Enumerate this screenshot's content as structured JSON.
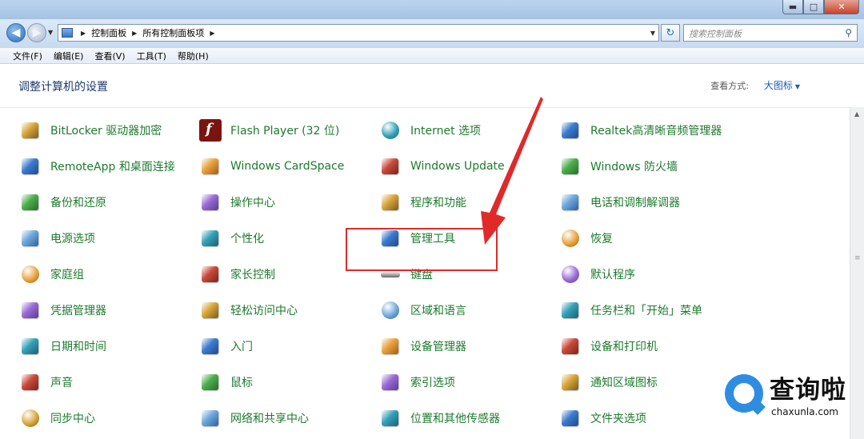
{
  "window": {
    "minimize_label": "▬",
    "maximize_label": "□",
    "close_label": "✕"
  },
  "address": {
    "breadcrumb": [
      "控制面板",
      "所有控制面板项"
    ],
    "search_placeholder": "搜索控制面板"
  },
  "menu": [
    "文件(F)",
    "编辑(E)",
    "查看(V)",
    "工具(T)",
    "帮助(H)"
  ],
  "header": {
    "title": "调整计算机的设置",
    "view_by_label": "查看方式:",
    "view_by_value": "大图标"
  },
  "columns": [
    [
      "BitLocker 驱动器加密",
      "RemoteApp 和桌面连接",
      "备份和还原",
      "电源选项",
      "家庭组",
      "凭据管理器",
      "日期和时间",
      "声音",
      "同步中心"
    ],
    [
      "Flash Player (32 位)",
      "Windows CardSpace",
      "操作中心",
      "个性化",
      "家长控制",
      "轻松访问中心",
      "入门",
      "鼠标",
      "网络和共享中心"
    ],
    [
      "Internet 选项",
      "Windows Update",
      "程序和功能",
      "管理工具",
      "键盘",
      "区域和语言",
      "设备管理器",
      "索引选项",
      "位置和其他传感器"
    ],
    [
      "Realtek高清晰音频管理器",
      "Windows 防火墙",
      "电话和调制解调器",
      "恢复",
      "默认程序",
      "任务栏和「开始」菜单",
      "设备和打印机",
      "通知区域图标",
      "文件夹选项"
    ]
  ],
  "icons": [
    [
      "key-lock-icon",
      "remoteapp-icon",
      "backup-icon",
      "power-battery-icon",
      "homegroup-icon",
      "credential-safe-icon",
      "calendar-clock-icon",
      "speaker-icon",
      "sync-icon"
    ],
    [
      "flash-icon",
      "cardspace-icon",
      "action-center-flag-icon",
      "personalization-monitor-icon",
      "parental-controls-icon",
      "ease-of-access-icon",
      "getting-started-icon",
      "mouse-icon",
      "network-icon"
    ],
    [
      "internet-options-icon",
      "windows-update-icon",
      "programs-features-icon",
      "admin-tools-icon",
      "keyboard-icon",
      "region-globe-icon",
      "device-manager-icon",
      "indexing-icon",
      "location-sensor-icon"
    ],
    [
      "realtek-audio-icon",
      "firewall-icon",
      "phone-modem-icon",
      "recovery-icon",
      "default-programs-icon",
      "taskbar-icon",
      "devices-printers-icon",
      "notification-icon",
      "folder-options-icon"
    ]
  ],
  "annotation": {
    "highlighted_item": "管理工具",
    "color": "#e02a2a"
  },
  "watermark": {
    "cn": "查询啦",
    "en": "chaxunla.com"
  },
  "colors": {
    "item_text": "#1e7a2e",
    "title_text": "#1e3b6e",
    "link": "#1c5bbb",
    "accent": "#2e8de0"
  }
}
